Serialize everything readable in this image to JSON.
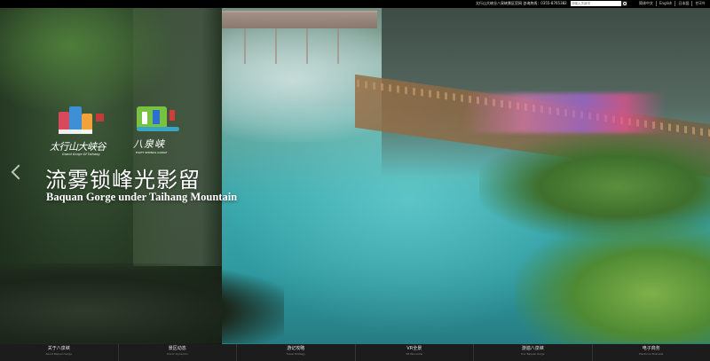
{
  "topbar": {
    "info": "太行山大峡谷八泉峡景区官网  咨询热线：0355-8765382",
    "search_placeholder": "请输入关键词",
    "languages": [
      "简体中文",
      "English",
      "日本語",
      "한국어"
    ]
  },
  "logos": {
    "left_cn": "太行山大峡谷",
    "left_en": "Grand Gorge Of Taihang",
    "right_cn": "八泉峡",
    "right_en": "EIGHT SPRINGS GORGE"
  },
  "hero": {
    "title_cn": "流雾锁峰光影留",
    "title_en": "Baquan Gorge under Taihang Mountain"
  },
  "nav": [
    {
      "cn": "关于八泉峡",
      "en": "About Baquan Gorge"
    },
    {
      "cn": "景区动态",
      "en": "Scenic Dynamics"
    },
    {
      "cn": "游记攻略",
      "en": "Travel Strategy"
    },
    {
      "cn": "VR全景",
      "en": "VR Panorama"
    },
    {
      "cn": "游遍八泉峡",
      "en": "Tour Baquan Gorge"
    },
    {
      "cn": "电子商务",
      "en": "Electronic Business"
    }
  ]
}
